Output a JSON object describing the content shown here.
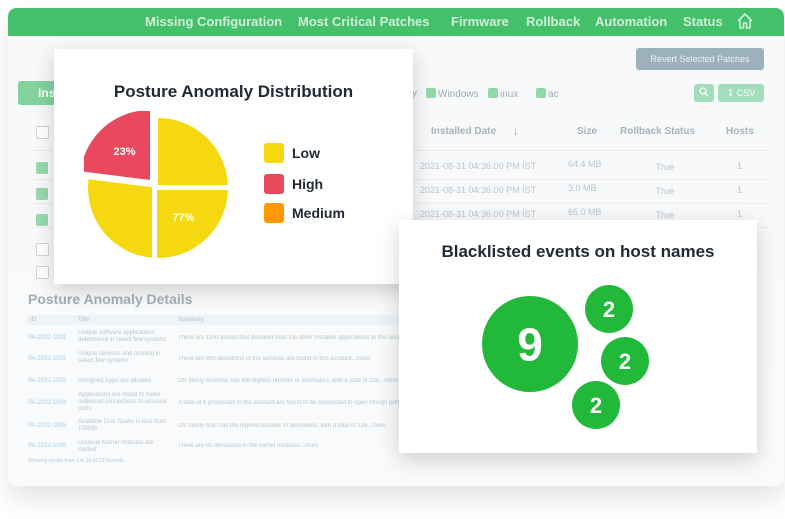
{
  "nav": {
    "items": [
      "Missing Configuration",
      "Most Critical Patches",
      "Firmware",
      "Rollback",
      "Automation",
      "Status"
    ]
  },
  "toolbar": {
    "revert_label": "Revert Selected Patches",
    "left_tab_label": "Ins",
    "filters": [
      "Windows",
      "inux",
      "ac"
    ],
    "filter_prefix": "y",
    "csv_label": "CSV"
  },
  "patch_table": {
    "headers": [
      "Installed Date",
      "Size",
      "Rollback Status",
      "Hosts"
    ],
    "rows": [
      [
        "2021-08-31 04:36:00 PM IST",
        "64.4 MB",
        "True",
        "1"
      ],
      [
        "2021-08-31 04:36:00 PM IST",
        "3.0 MB",
        "True",
        "1"
      ],
      [
        "2021-08-31 04:36:00 PM IST",
        "65.0 MB",
        "True",
        "1"
      ]
    ]
  },
  "details": {
    "title": "Posture Anomaly Details",
    "headers": [
      "ID",
      "Title",
      "Summary"
    ],
    "rows": [
      [
        "PA-2022-1001",
        "Unique software applications determined in select few systems",
        "There are 1100 assets that deviated from the other installed applications in this account...more"
      ],
      [
        "PA-2022-1002",
        "Unique services and running in select few systems",
        "There are 386 deviations in the services are found in this account...more"
      ],
      [
        "PA-2022-1003",
        "Unsigned Apps are allowed",
        "OS family windows has the highest number of anomalies, with a total of 236...more"
      ],
      [
        "PA-2022-1004",
        "Applications are found to make outbound connections to unusual ports",
        "A total of 8 processes in the account are found to be connected to open foreign ports"
      ],
      [
        "PA-2022-1005",
        "Available Disk Space is less than 100MB",
        "OS family mac has the highest number of anomalies, with a total of 126...more"
      ],
      [
        "PA-2022-1006",
        "Unusual Kernel modules are loaded",
        "There are 86 deviations in the kernel modules...more"
      ]
    ],
    "footer": "Showing results from 1 to 10 of 13 Records"
  },
  "pie_card": {
    "title": "Posture Anomaly Distribution",
    "legend": [
      {
        "label": "Low",
        "color": "#f5d80f"
      },
      {
        "label": "High",
        "color": "#e9495f"
      },
      {
        "label": "Medium",
        "color": "#ff9800"
      }
    ]
  },
  "chart_data": {
    "type": "pie",
    "title": "Posture Anomaly Distribution",
    "slices": [
      {
        "label": "Low",
        "value": 77,
        "display": "77%",
        "color": "#f5d80f"
      },
      {
        "label": "High",
        "value": 23,
        "display": "23%",
        "color": "#e9495f"
      },
      {
        "label": "Medium",
        "value": 0,
        "display": "",
        "color": "#ff9800"
      }
    ]
  },
  "blacklist_card": {
    "title": "Blacklisted events on host names",
    "color": "#22b83a",
    "bubbles": [
      {
        "value": "9"
      },
      {
        "value": "2"
      },
      {
        "value": "2"
      },
      {
        "value": "2"
      }
    ]
  }
}
